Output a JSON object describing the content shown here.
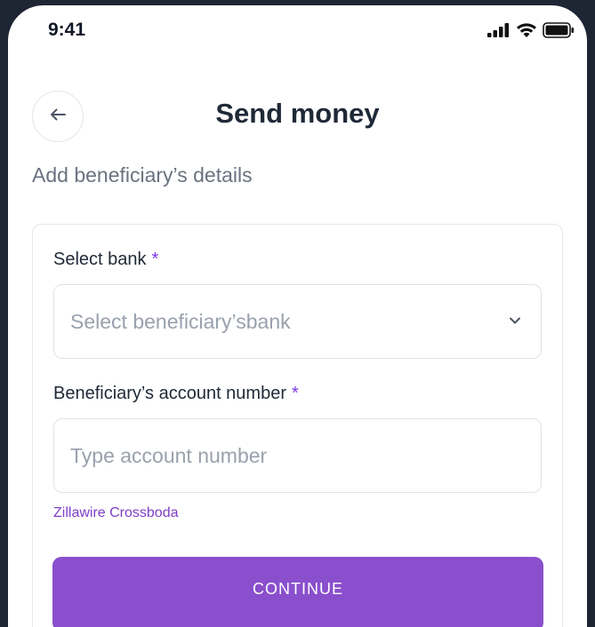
{
  "status_bar": {
    "time": "9:41",
    "icons": [
      "cellular-signal-icon",
      "wifi-icon",
      "battery-icon"
    ]
  },
  "header": {
    "back_icon": "arrow-left-icon",
    "title": "Send money"
  },
  "subtitle": "Add beneficiary’s details",
  "form": {
    "bank": {
      "label": "Select bank",
      "required_mark": "*",
      "placeholder": "Select beneficiary’sbank",
      "icon": "chevron-down-icon"
    },
    "account_number": {
      "label": "Beneficiary’s account number",
      "required_mark": "*",
      "placeholder": "Type account number"
    },
    "resolved_name": "Zillawire Crossboda",
    "submit_label": "CONTINUE"
  },
  "colors": {
    "accent": "#8a4fcc",
    "required": "#7c3aed",
    "frame": "#1e2533"
  }
}
